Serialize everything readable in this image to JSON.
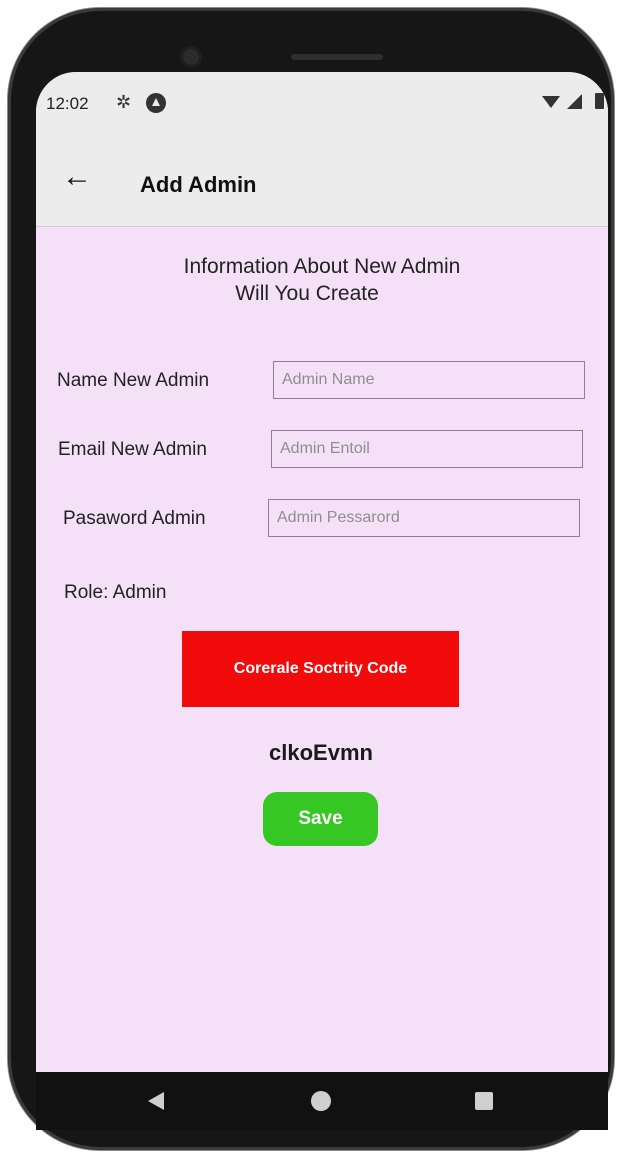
{
  "status_bar": {
    "time": "12:02"
  },
  "app_bar": {
    "back_label": "←",
    "title": "Add Admin"
  },
  "info": {
    "line1": "Information About New Admin",
    "line2": "Will You Create"
  },
  "form": {
    "name": {
      "label": "Name New Admin",
      "placeholder": "Admin Name",
      "value": ""
    },
    "email": {
      "label": "Email New Admin",
      "placeholder": "Admin Entoil",
      "value": ""
    },
    "password": {
      "label": "Pasaword Admin",
      "placeholder": "Admin Pessarord",
      "value": ""
    }
  },
  "role_text": "Role: Admin",
  "generate_button_label": "Corerale Soctrity Code",
  "security_code": "clkoEvmn",
  "save_button_label": "Save",
  "colors": {
    "generate_button": "#f10b0b",
    "save_button": "#37c724",
    "screen_background": "#f4e1f8",
    "app_bar": "#ececec"
  },
  "icons": [
    "settings-gear-icon",
    "sync-icon",
    "wifi-icon",
    "signal-icon",
    "battery-icon",
    "back-arrow-icon",
    "nav-back-icon",
    "nav-home-icon",
    "nav-recent-icon"
  ]
}
